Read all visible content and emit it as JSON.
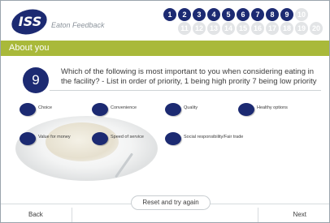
{
  "header": {
    "logo_text": "ISS",
    "brand": "Eaton Feedback",
    "steps_row1": [
      "1",
      "2",
      "3",
      "4",
      "5",
      "6",
      "7",
      "8",
      "9",
      "10"
    ],
    "steps_row2": [
      "11",
      "12",
      "13",
      "14",
      "15",
      "16",
      "17",
      "18",
      "19",
      "20"
    ],
    "current_step": "9"
  },
  "section": {
    "title": "About you"
  },
  "question": {
    "number": "9",
    "text": "Which of the following is most important to you when considering eating in the facility? - List in order of priority, 1 being high prority 7 being low priority",
    "options": [
      {
        "label": "Choice"
      },
      {
        "label": "Convenience"
      },
      {
        "label": "Quality"
      },
      {
        "label": "Healthy options"
      },
      {
        "label": "Value for money"
      },
      {
        "label": "Speed of service"
      },
      {
        "label": "Social responsibility/Fair trade"
      }
    ]
  },
  "footer": {
    "reset_label": "Reset and try again",
    "back_label": "Back",
    "next_label": "Next"
  },
  "colors": {
    "navy": "#1c2a72",
    "olive": "#a9b93a",
    "grey_step": "#e2e4e6"
  }
}
